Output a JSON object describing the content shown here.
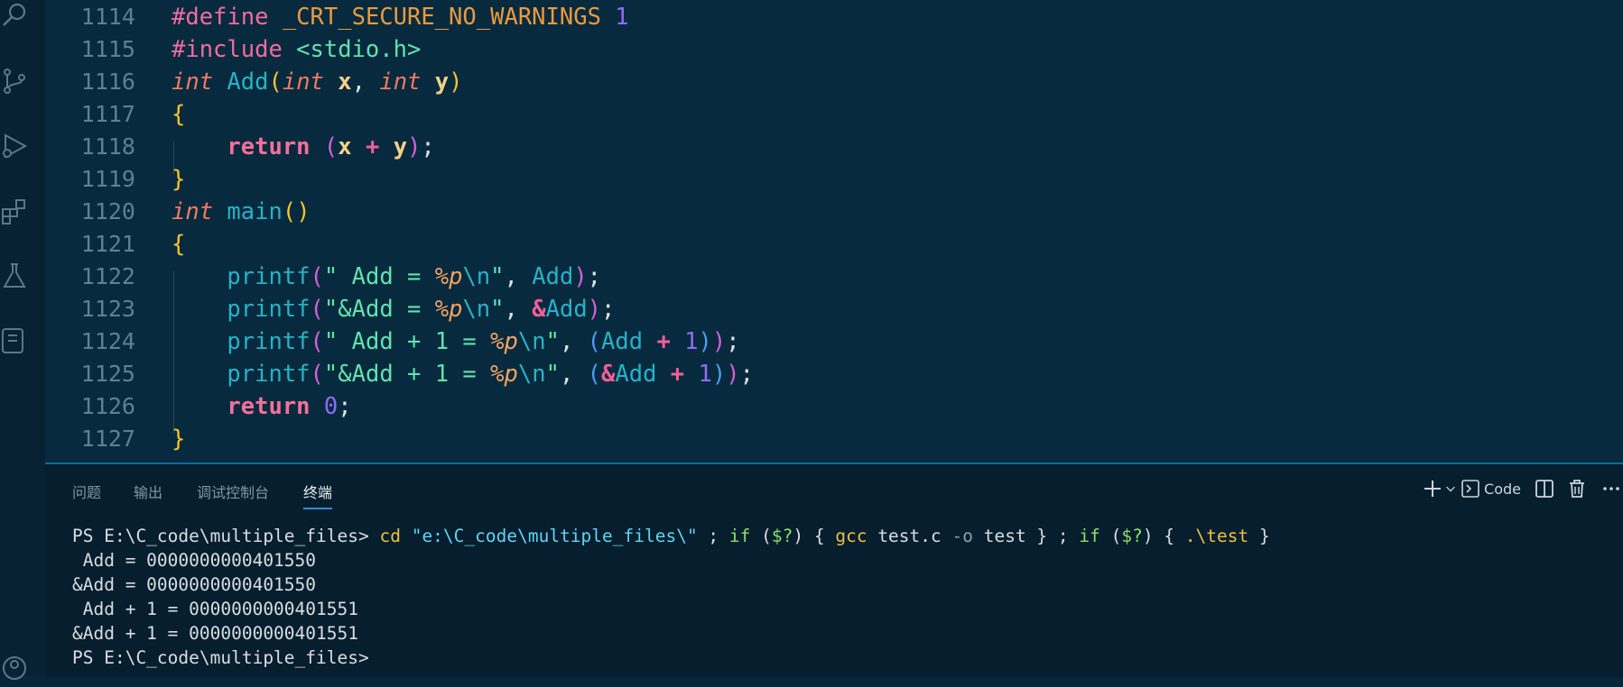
{
  "activity_bar": {
    "icons": [
      "search-icon",
      "source-control-icon",
      "run-debug-icon",
      "extensions-icon",
      "testing-icon",
      "notebook-icon",
      "account-icon"
    ]
  },
  "editor": {
    "lines": [
      {
        "num": "1114",
        "tokens": [
          {
            "t": "#define ",
            "c": "pre"
          },
          {
            "t": "_CRT_SECURE_NO_WARNINGS",
            "c": "macro"
          },
          {
            "t": " ",
            "c": "punct"
          },
          {
            "t": "1",
            "c": "num"
          }
        ]
      },
      {
        "num": "1115",
        "tokens": [
          {
            "t": "#include ",
            "c": "pre"
          },
          {
            "t": "<stdio.h>",
            "c": "inc"
          }
        ]
      },
      {
        "num": "1116",
        "tokens": [
          {
            "t": "int",
            "c": "type"
          },
          {
            "t": " ",
            "c": "punct"
          },
          {
            "t": "Add",
            "c": "fn"
          },
          {
            "t": "(",
            "c": "p1"
          },
          {
            "t": "int",
            "c": "type"
          },
          {
            "t": " ",
            "c": "punct"
          },
          {
            "t": "x",
            "c": "param"
          },
          {
            "t": ", ",
            "c": "punct"
          },
          {
            "t": "int",
            "c": "type"
          },
          {
            "t": " ",
            "c": "punct"
          },
          {
            "t": "y",
            "c": "param"
          },
          {
            "t": ")",
            "c": "p1"
          }
        ]
      },
      {
        "num": "1117",
        "tokens": [
          {
            "t": "{",
            "c": "p1"
          }
        ]
      },
      {
        "num": "1118",
        "tokens": [
          {
            "t": "    ",
            "c": "punct"
          },
          {
            "t": "return",
            "c": "kw"
          },
          {
            "t": " ",
            "c": "punct"
          },
          {
            "t": "(",
            "c": "p2"
          },
          {
            "t": "x",
            "c": "param"
          },
          {
            "t": " ",
            "c": "punct"
          },
          {
            "t": "+",
            "c": "op"
          },
          {
            "t": " ",
            "c": "punct"
          },
          {
            "t": "y",
            "c": "param"
          },
          {
            "t": ")",
            "c": "p2"
          },
          {
            "t": ";",
            "c": "punct"
          }
        ]
      },
      {
        "num": "1119",
        "tokens": [
          {
            "t": "}",
            "c": "p1"
          }
        ]
      },
      {
        "num": "1120",
        "tokens": [
          {
            "t": "int",
            "c": "type"
          },
          {
            "t": " ",
            "c": "punct"
          },
          {
            "t": "main",
            "c": "fn"
          },
          {
            "t": "()",
            "c": "p1"
          }
        ]
      },
      {
        "num": "1121",
        "tokens": [
          {
            "t": "{",
            "c": "p1"
          }
        ]
      },
      {
        "num": "1122",
        "tokens": [
          {
            "t": "    ",
            "c": "punct"
          },
          {
            "t": "printf",
            "c": "fn"
          },
          {
            "t": "(",
            "c": "p2"
          },
          {
            "t": "\" Add = ",
            "c": "str"
          },
          {
            "t": "%p",
            "c": "fmt"
          },
          {
            "t": "\\n",
            "c": "esc"
          },
          {
            "t": "\"",
            "c": "str"
          },
          {
            "t": ", ",
            "c": "punct"
          },
          {
            "t": "Add",
            "c": "id"
          },
          {
            "t": ")",
            "c": "p2"
          },
          {
            "t": ";",
            "c": "punct"
          }
        ]
      },
      {
        "num": "1123",
        "tokens": [
          {
            "t": "    ",
            "c": "punct"
          },
          {
            "t": "printf",
            "c": "fn"
          },
          {
            "t": "(",
            "c": "p2"
          },
          {
            "t": "\"&Add = ",
            "c": "str"
          },
          {
            "t": "%p",
            "c": "fmt"
          },
          {
            "t": "\\n",
            "c": "esc"
          },
          {
            "t": "\"",
            "c": "str"
          },
          {
            "t": ", ",
            "c": "punct"
          },
          {
            "t": "&",
            "c": "op"
          },
          {
            "t": "Add",
            "c": "id"
          },
          {
            "t": ")",
            "c": "p2"
          },
          {
            "t": ";",
            "c": "punct"
          }
        ]
      },
      {
        "num": "1124",
        "tokens": [
          {
            "t": "    ",
            "c": "punct"
          },
          {
            "t": "printf",
            "c": "fn"
          },
          {
            "t": "(",
            "c": "p2"
          },
          {
            "t": "\" Add + 1 = ",
            "c": "str"
          },
          {
            "t": "%p",
            "c": "fmt"
          },
          {
            "t": "\\n",
            "c": "esc"
          },
          {
            "t": "\"",
            "c": "str"
          },
          {
            "t": ", ",
            "c": "punct"
          },
          {
            "t": "(",
            "c": "p3"
          },
          {
            "t": "Add",
            "c": "id"
          },
          {
            "t": " ",
            "c": "punct"
          },
          {
            "t": "+",
            "c": "op"
          },
          {
            "t": " ",
            "c": "punct"
          },
          {
            "t": "1",
            "c": "num"
          },
          {
            "t": ")",
            "c": "p3"
          },
          {
            "t": ")",
            "c": "p2"
          },
          {
            "t": ";",
            "c": "punct"
          }
        ]
      },
      {
        "num": "1125",
        "tokens": [
          {
            "t": "    ",
            "c": "punct"
          },
          {
            "t": "printf",
            "c": "fn"
          },
          {
            "t": "(",
            "c": "p2"
          },
          {
            "t": "\"&Add + 1 = ",
            "c": "str"
          },
          {
            "t": "%p",
            "c": "fmt"
          },
          {
            "t": "\\n",
            "c": "esc"
          },
          {
            "t": "\"",
            "c": "str"
          },
          {
            "t": ", ",
            "c": "punct"
          },
          {
            "t": "(",
            "c": "p3"
          },
          {
            "t": "&",
            "c": "op"
          },
          {
            "t": "Add",
            "c": "id"
          },
          {
            "t": " ",
            "c": "punct"
          },
          {
            "t": "+",
            "c": "op"
          },
          {
            "t": " ",
            "c": "punct"
          },
          {
            "t": "1",
            "c": "num"
          },
          {
            "t": ")",
            "c": "p3"
          },
          {
            "t": ")",
            "c": "p2"
          },
          {
            "t": ";",
            "c": "punct"
          }
        ]
      },
      {
        "num": "1126",
        "tokens": [
          {
            "t": "    ",
            "c": "punct"
          },
          {
            "t": "return",
            "c": "kw"
          },
          {
            "t": " ",
            "c": "punct"
          },
          {
            "t": "0",
            "c": "num"
          },
          {
            "t": ";",
            "c": "punct"
          }
        ]
      },
      {
        "num": "1127",
        "tokens": [
          {
            "t": "}",
            "c": "p1"
          }
        ]
      }
    ]
  },
  "panel": {
    "tabs": [
      {
        "label": "问题",
        "active": false
      },
      {
        "label": "输出",
        "active": false
      },
      {
        "label": "调试控制台",
        "active": false
      },
      {
        "label": "终端",
        "active": true
      }
    ],
    "actions": {
      "new_terminal_icon": "plus-icon",
      "dropdown_icon": "chevron-down-icon",
      "shell_label": "Code",
      "split_icon": "split-icon",
      "kill_icon": "trash-icon",
      "more_icon": "ellipsis-icon"
    }
  },
  "terminal": {
    "lines": [
      [
        {
          "t": "PS E:\\C_code\\multiple_files> ",
          "c": "white"
        },
        {
          "t": "cd ",
          "c": "yellow"
        },
        {
          "t": "\"e:\\C_code\\multiple_files\\\"",
          "c": "cyan"
        },
        {
          "t": " ; ",
          "c": "white"
        },
        {
          "t": "if",
          "c": "green"
        },
        {
          "t": " (",
          "c": "white"
        },
        {
          "t": "$?",
          "c": "green"
        },
        {
          "t": ") { ",
          "c": "white"
        },
        {
          "t": "gcc",
          "c": "yellow"
        },
        {
          "t": " test.c ",
          "c": "white"
        },
        {
          "t": "-o",
          "c": "gray"
        },
        {
          "t": " test } ; ",
          "c": "white"
        },
        {
          "t": "if",
          "c": "green"
        },
        {
          "t": " (",
          "c": "white"
        },
        {
          "t": "$?",
          "c": "green"
        },
        {
          "t": ") { ",
          "c": "white"
        },
        {
          "t": ".\\test",
          "c": "yellow"
        },
        {
          "t": " }",
          "c": "white"
        }
      ],
      [
        {
          "t": " Add = 0000000000401550",
          "c": "white"
        }
      ],
      [
        {
          "t": "&Add = 0000000000401550",
          "c": "white"
        }
      ],
      [
        {
          "t": " Add + 1 = 0000000000401551",
          "c": "white"
        }
      ],
      [
        {
          "t": "&Add + 1 = 0000000000401551",
          "c": "white"
        }
      ],
      [
        {
          "t": "PS E:\\C_code\\multiple_files>",
          "c": "white"
        }
      ]
    ]
  }
}
